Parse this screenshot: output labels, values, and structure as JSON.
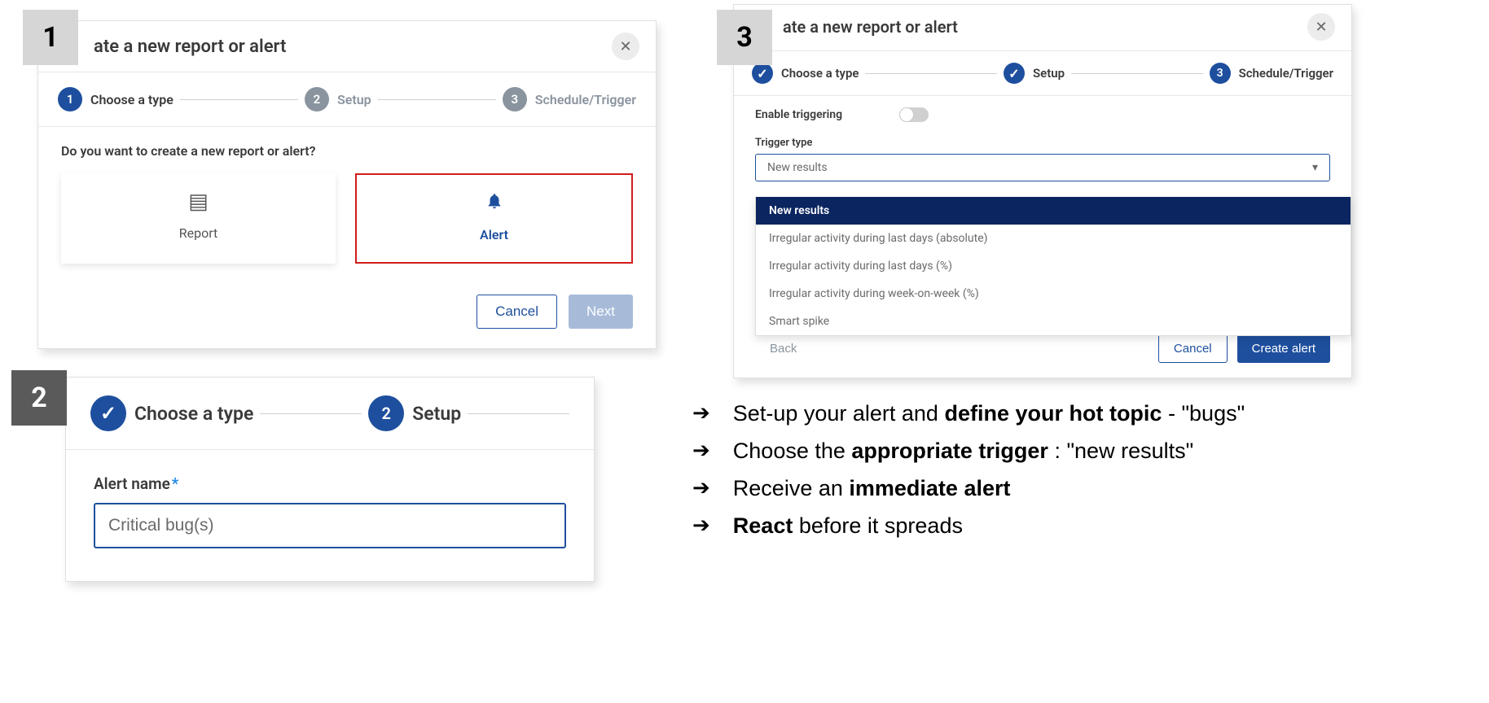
{
  "badges": {
    "one": "1",
    "two": "2",
    "three": "3"
  },
  "panel1": {
    "title": "ate a new report or alert",
    "steps": {
      "s1": {
        "num": "1",
        "label": "Choose a type"
      },
      "s2": {
        "num": "2",
        "label": "Setup"
      },
      "s3": {
        "num": "3",
        "label": "Schedule/Trigger"
      }
    },
    "question": "Do you want to create a new report or alert?",
    "cards": {
      "report": "Report",
      "alert": "Alert"
    },
    "buttons": {
      "cancel": "Cancel",
      "next": "Next"
    }
  },
  "panel2": {
    "steps": {
      "s1": {
        "label": "Choose a type"
      },
      "s2": {
        "num": "2",
        "label": "Setup"
      }
    },
    "field_label": "Alert name",
    "field_value": "Critical bug(s)"
  },
  "panel3": {
    "title": "ate a new report or alert",
    "steps": {
      "s1": {
        "label": "Choose a type"
      },
      "s2": {
        "label": "Setup"
      },
      "s3": {
        "num": "3",
        "label": "Schedule/Trigger"
      }
    },
    "toggle_label": "Enable triggering",
    "select_label": "Trigger type",
    "select_value": "New results",
    "options": [
      "New results",
      "Irregular activity during last days (absolute)",
      "Irregular activity during last days (%)",
      "Irregular activity during week-on-week (%)",
      "Smart spike"
    ],
    "buttons": {
      "back": "Back",
      "cancel": "Cancel",
      "create": "Create alert"
    }
  },
  "bullets": {
    "b1_pre": "Set-up your alert and ",
    "b1_bold": "define your hot topic",
    "b1_post": " - \"bugs\"",
    "b2_pre": "Choose the ",
    "b2_bold": "appropriate trigger",
    "b2_post": " : \"new results\"",
    "b3_pre": "Receive  an ",
    "b3_bold": "immediate alert",
    "b4_bold": "React",
    "b4_post": " before it spreads"
  }
}
